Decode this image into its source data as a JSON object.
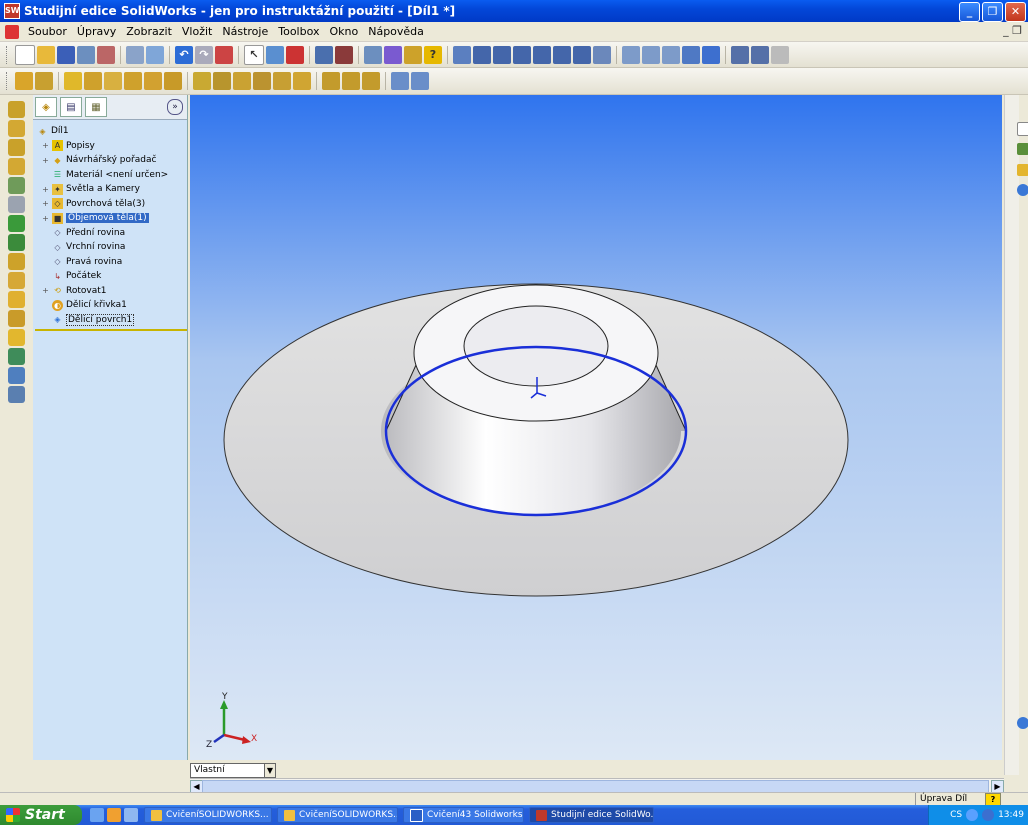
{
  "window": {
    "title": "Studijní edice SolidWorks - jen pro instruktážní použití - [Díl1 *]"
  },
  "menu": [
    "Soubor",
    "Úpravy",
    "Zobrazit",
    "Vložit",
    "Nástroje",
    "Toolbox",
    "Okno",
    "Nápověda"
  ],
  "feature_tree": {
    "root": "Díl1",
    "items": [
      {
        "label": "Popisy",
        "icon": "annotations-icon",
        "expandable": true
      },
      {
        "label": "Návrhářský pořadač",
        "icon": "design-binder-icon",
        "expandable": true
      },
      {
        "label": "Materiál <není určen>",
        "icon": "material-icon",
        "expandable": false
      },
      {
        "label": "Světla a Kamery",
        "icon": "lights-cameras-icon",
        "expandable": true
      },
      {
        "label": "Povrchová těla(3)",
        "icon": "surface-bodies-icon",
        "expandable": true
      },
      {
        "label": "Objemová těla(1)",
        "icon": "solid-bodies-icon",
        "expandable": true
      },
      {
        "label": "Přední rovina",
        "icon": "plane-icon",
        "expandable": false
      },
      {
        "label": "Vrchní rovina",
        "icon": "plane-icon",
        "expandable": false
      },
      {
        "label": "Pravá rovina",
        "icon": "plane-icon",
        "expandable": false
      },
      {
        "label": "Počátek",
        "icon": "origin-icon",
        "expandable": false
      },
      {
        "label": "Rotovat1",
        "icon": "revolve-icon",
        "expandable": true
      },
      {
        "label": "Dělicí křivka1",
        "icon": "split-line-icon",
        "expandable": false
      },
      {
        "label": "Dělicí povrch1",
        "icon": "parting-surface-icon",
        "expandable": false
      }
    ]
  },
  "triad": {
    "x": "X",
    "y": "Y",
    "z": "Z"
  },
  "configuration": {
    "value": "Vlastní"
  },
  "status": {
    "mode": "Úprava Díl",
    "help": "?"
  },
  "taskbar": {
    "start": "Start",
    "items": [
      "CvičeníSOLIDWORKS...",
      "CvičeníSOLIDWORKS...",
      "Cvičení43 Solidworks....",
      "Studijní edice SolidWo..."
    ],
    "lang": "CS",
    "clock": "13:49"
  },
  "colors": {
    "title_bar": "#0a5cf0",
    "selected_edge": "#1a2fd8",
    "tree_bg": "#cfe3f7",
    "viewport_top": "#2f74ee"
  }
}
